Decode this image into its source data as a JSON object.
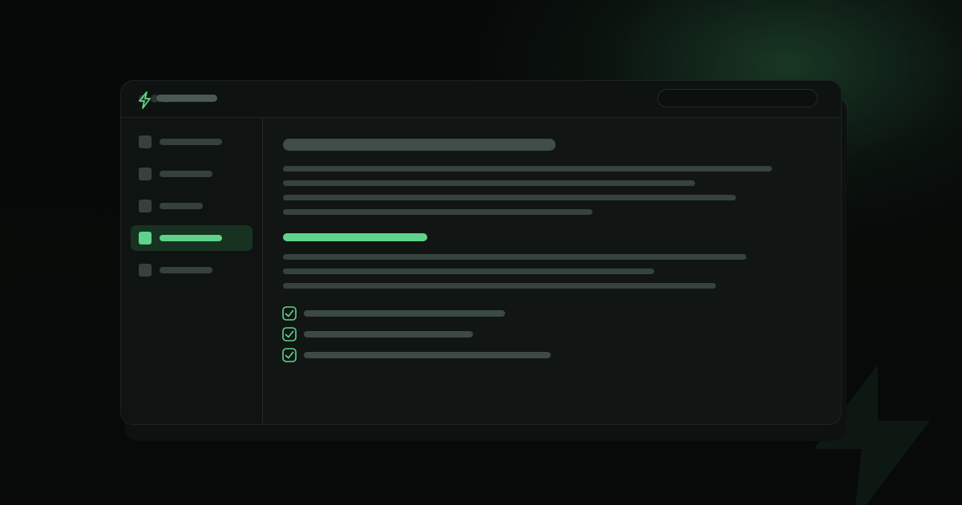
{
  "theme": {
    "background": "#070908",
    "window_background": "#111614",
    "sidebar_background": "#0f1412",
    "accent": "#5fd38a",
    "placeholder_gray": "#36433d"
  },
  "titlebar": {
    "logo_icon": "lightning-bolt-icon",
    "search": {
      "placeholder": "",
      "value": ""
    }
  },
  "sidebar": {
    "items": [
      {
        "icon": "square-icon",
        "label": "",
        "active": false
      },
      {
        "icon": "square-icon",
        "label": "",
        "active": false
      },
      {
        "icon": "square-icon",
        "label": "",
        "active": false
      },
      {
        "icon": "square-icon",
        "label": "",
        "active": true
      },
      {
        "icon": "square-icon",
        "label": "",
        "active": false
      }
    ]
  },
  "content": {
    "checklist": [
      {
        "icon": "checkbox-checked-icon",
        "checked": true
      },
      {
        "icon": "checkbox-checked-icon",
        "checked": true
      },
      {
        "icon": "checkbox-checked-icon",
        "checked": true
      }
    ]
  },
  "decor": {
    "background_icon": "lightning-bolt-icon"
  }
}
